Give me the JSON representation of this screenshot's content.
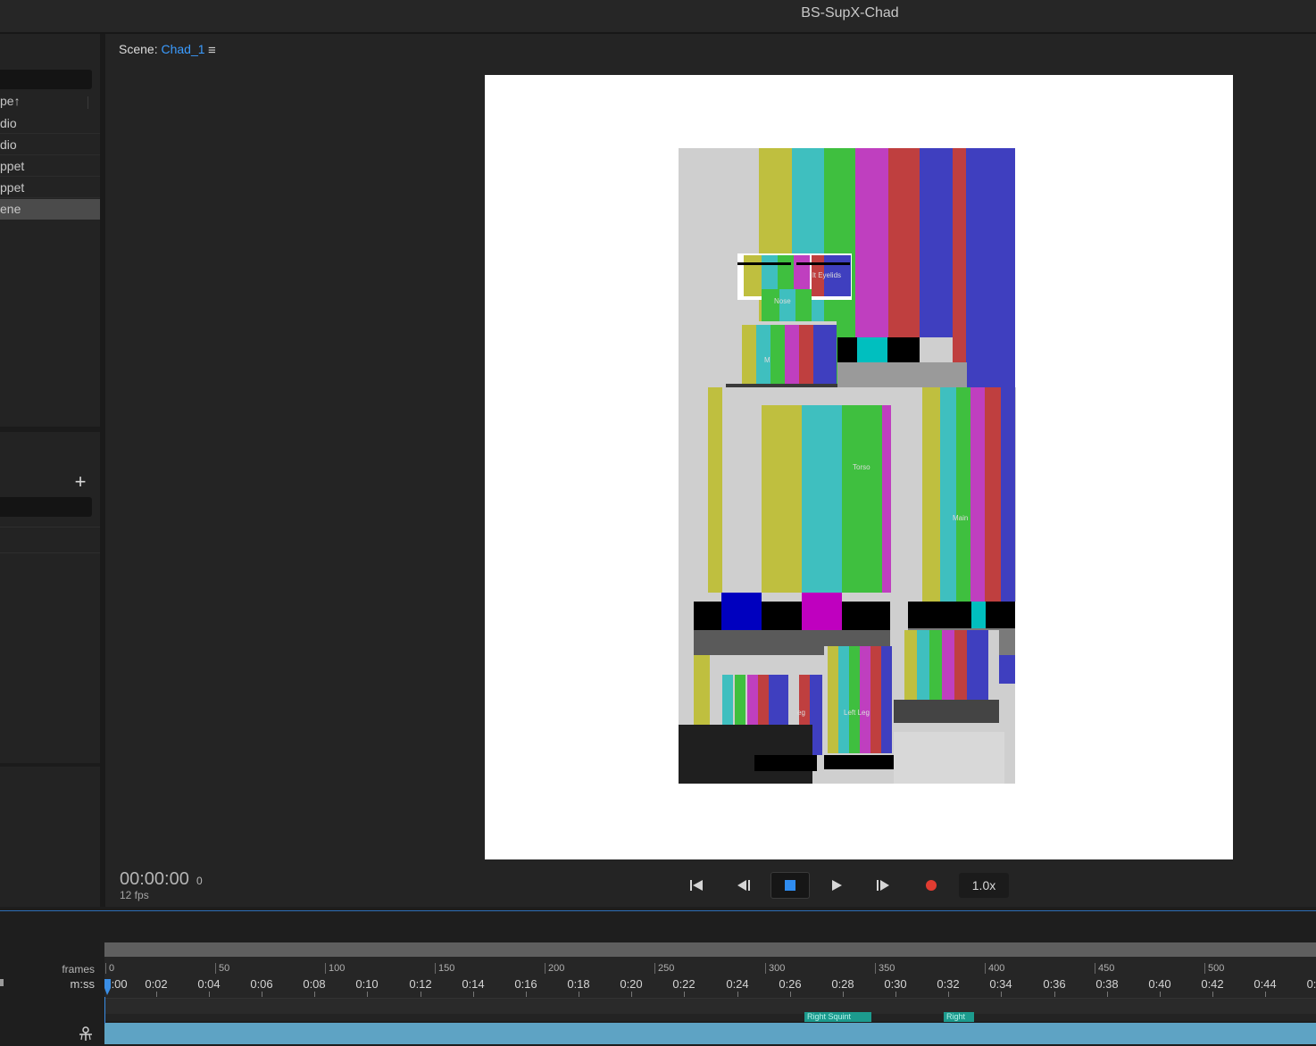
{
  "app": {
    "title": "BS-SupX-Chad"
  },
  "project_panel": {
    "column_header": "pe",
    "sort_indicator": "↑",
    "rows": [
      {
        "label": "dio"
      },
      {
        "label": "dio"
      },
      {
        "label": "ppet"
      },
      {
        "label": "ppet"
      },
      {
        "label": "ene",
        "selected": true
      }
    ],
    "add_icon": "plus-icon"
  },
  "scene": {
    "prefix": "Scene:",
    "name": "Chad_1",
    "menu_icon": "hamburger-menu-icon",
    "puppet_labels": {
      "eyelids": "lt Eyelids",
      "nose": "Nose",
      "mouth": "M",
      "torso": "Torso",
      "main": "Main",
      "leg_right": "eg",
      "leg_left": "Left Leg"
    }
  },
  "transport": {
    "time": "00:00:00",
    "frame": "0",
    "fps": "12 fps",
    "speed": "1.0x",
    "record_color": "#e03c31",
    "stop_color": "#2f8cf0",
    "buttons": [
      "go-to-start-icon",
      "step-back-icon",
      "stop-icon",
      "play-icon",
      "step-forward-icon",
      "record-icon"
    ]
  },
  "timeline": {
    "frames_label": "frames",
    "time_label": "m:ss",
    "frame_marks": [
      "0",
      "50",
      "100",
      "150",
      "200",
      "250",
      "300",
      "350",
      "400",
      "450",
      "500"
    ],
    "time_marks": [
      "0:00",
      "0:02",
      "0:04",
      "0:06",
      "0:08",
      "0:10",
      "0:12",
      "0:14",
      "0:16",
      "0:18",
      "0:20",
      "0:22",
      "0:24",
      "0:26",
      "0:28",
      "0:30",
      "0:32",
      "0:34",
      "0:36",
      "0:38",
      "0:40",
      "0:42",
      "0:44",
      "0:"
    ],
    "markers": [
      {
        "label": "Right Squint"
      },
      {
        "label": "Right"
      }
    ],
    "track_color": "#5ea3c4"
  }
}
